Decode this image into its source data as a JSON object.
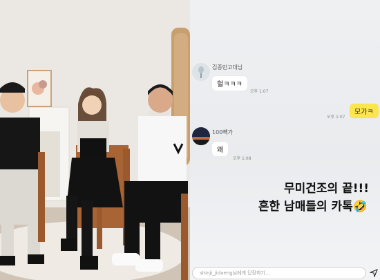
{
  "chat": {
    "messages": [
      {
        "sender": "김종민고대님",
        "text": "헐ㅋㅋㅋ",
        "time": "오후 1:07"
      },
      {
        "sender": "",
        "text": "모가ㅋ",
        "time": "오후 1:07"
      },
      {
        "sender": "100빽가",
        "text": "왜",
        "time": "오후 1:08"
      }
    ]
  },
  "caption": {
    "line1": "무미건조의 끝!!!",
    "line2": "흔한 남매들의 카톡",
    "emoji": "🤣"
  },
  "reply": {
    "placeholder": "shinji_jidaeng님에게 답장하기..."
  },
  "icons": {
    "share": "send-icon"
  }
}
